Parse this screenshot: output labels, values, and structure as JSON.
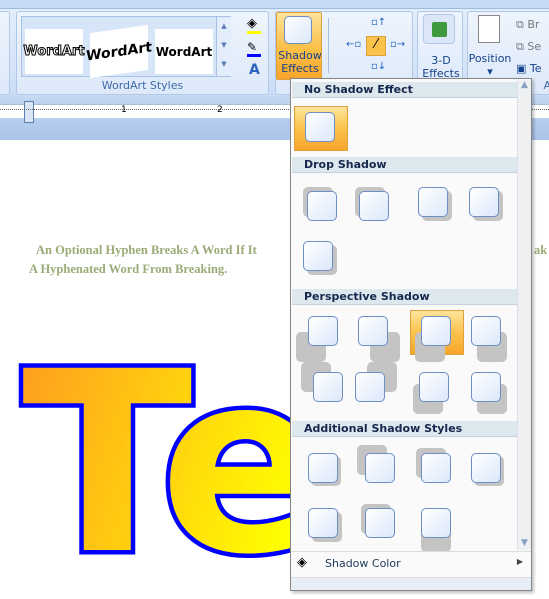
{
  "ribbon": {
    "wordart_styles": {
      "label": "WordArt Styles",
      "samples": [
        "WordArt",
        "WordArt",
        "WordArt"
      ]
    },
    "shadow_effects": {
      "label_line1": "Shadow",
      "label_line2": "Effects"
    },
    "three_d": {
      "label_line1": "3-D",
      "label_line2": "Effects"
    },
    "arrange": {
      "position_label": "Position",
      "bring_label": "Br",
      "send_label": "Se",
      "text_wrap_label": "Te",
      "group_label_fragment": "A"
    },
    "colors": {
      "fill": "#ffff00",
      "line": "#0000ff",
      "accent": "#f7a52c"
    }
  },
  "ruler": {
    "marks": [
      "1",
      "2"
    ]
  },
  "document": {
    "line1": "An Optional Hyphen Breaks A Word If It",
    "line1_right": "ak",
    "line2": "A Hyphenated  Word From Breaking.",
    "wordart_text": "Te"
  },
  "menu": {
    "sections": [
      {
        "title": "No Shadow Effect"
      },
      {
        "title": "Drop Shadow"
      },
      {
        "title": "Perspective Shadow"
      },
      {
        "title": "Additional Shadow Styles"
      }
    ],
    "shadow_color": "Shadow Color",
    "shadow_color_accesskey": "C"
  }
}
